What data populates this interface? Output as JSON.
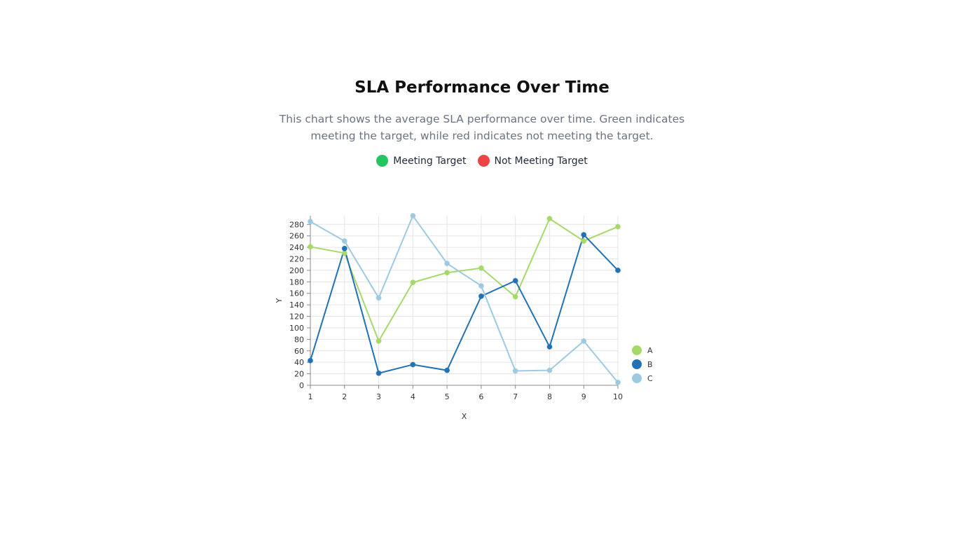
{
  "header": {
    "title": "SLA Performance Over Time",
    "description": "This chart shows the average SLA performance over time. Green indicates meeting the target, while red indicates not meeting the target."
  },
  "status_legend": [
    {
      "label": "Meeting Target",
      "color": "#22c55e"
    },
    {
      "label": "Not Meeting Target",
      "color": "#ef4444"
    }
  ],
  "chart_data": {
    "type": "line",
    "xlabel": "X",
    "ylabel": "Y",
    "x": [
      1,
      2,
      3,
      4,
      5,
      6,
      7,
      8,
      9,
      10
    ],
    "xlim": [
      1,
      10
    ],
    "ylim": [
      0,
      295
    ],
    "yticks": [
      0,
      20,
      40,
      60,
      80,
      100,
      120,
      140,
      160,
      180,
      200,
      220,
      240,
      260,
      280
    ],
    "grid": true,
    "legend_position": "right-bottom",
    "series": [
      {
        "name": "A",
        "color": "#a6d96a",
        "values": [
          241,
          230,
          77,
          179,
          196,
          204,
          154,
          290,
          251,
          276
        ]
      },
      {
        "name": "B",
        "color": "#2171b5",
        "values": [
          43,
          238,
          21,
          36,
          26,
          155,
          182,
          67,
          262,
          200
        ]
      },
      {
        "name": "C",
        "color": "#9ecae1",
        "values": [
          285,
          251,
          152,
          295,
          212,
          173,
          25,
          26,
          77,
          5
        ]
      }
    ]
  }
}
